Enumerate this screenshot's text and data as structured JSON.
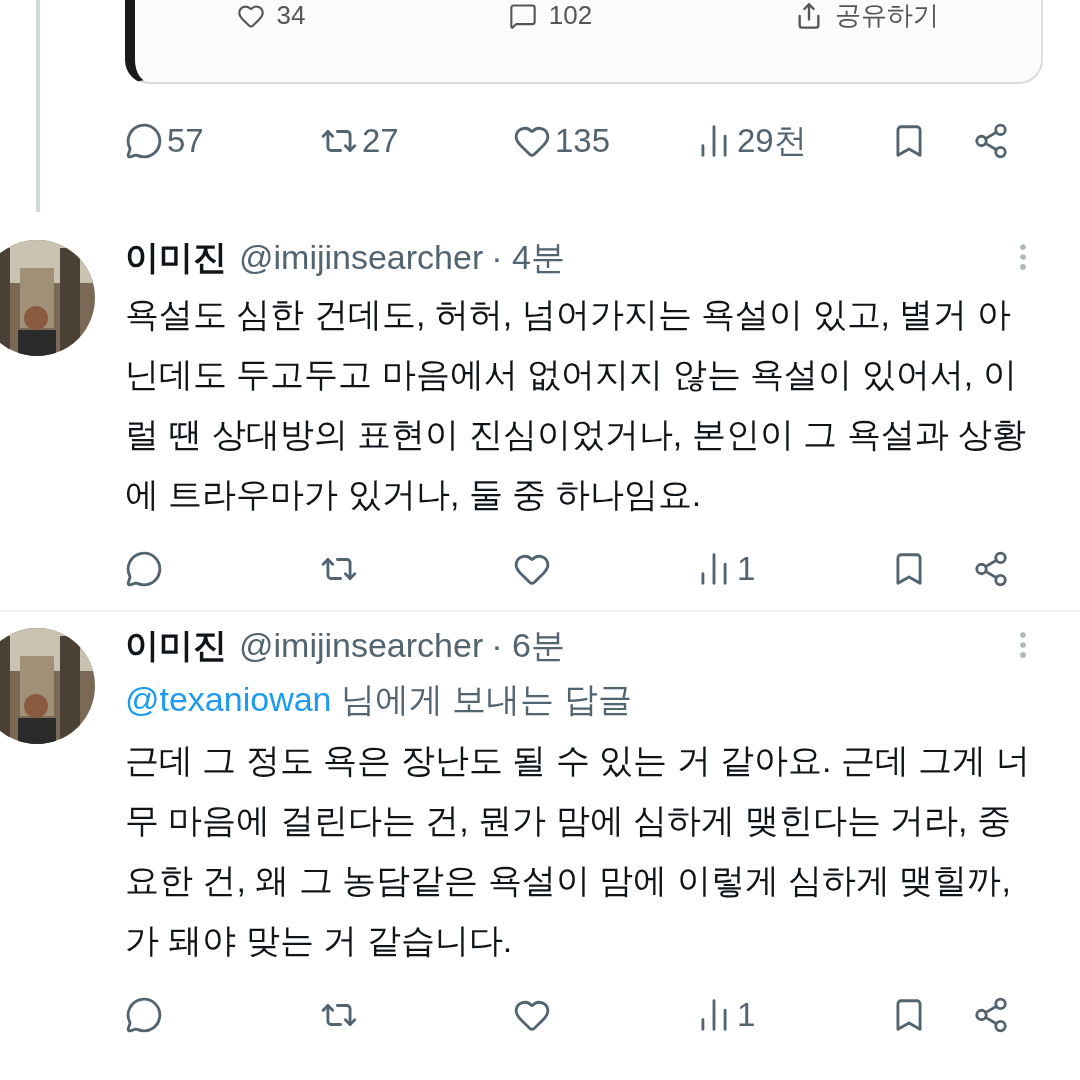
{
  "embedded_card": {
    "stats": [
      {
        "kind": "like",
        "label": "34"
      },
      {
        "kind": "comment",
        "label": "102"
      },
      {
        "kind": "share",
        "label": "공유하기"
      }
    ]
  },
  "main_actions": [
    {
      "kind": "reply",
      "label": "57"
    },
    {
      "kind": "repost",
      "label": "27"
    },
    {
      "kind": "like",
      "label": "135"
    },
    {
      "kind": "views",
      "label": "29천"
    },
    {
      "kind": "bookmark"
    },
    {
      "kind": "share"
    }
  ],
  "replies": [
    {
      "name": "이미진",
      "handle": "@imijinsearcher",
      "time": "· 4분",
      "body": "욕설도 심한 건데도, 허허, 넘어가지는 욕설이 있고, 별거 아닌데도 두고두고 마음에서 없어지지 않는 욕설이 있어서, 이럴 땐 상대방의 표현이 진심이었거나, 본인이 그 욕설과 상황에 트라우마가 있거나, 둘 중 하나임요.",
      "actions": [
        {
          "kind": "reply"
        },
        {
          "kind": "repost"
        },
        {
          "kind": "like"
        },
        {
          "kind": "views",
          "label": "1"
        },
        {
          "kind": "bookmark"
        },
        {
          "kind": "share"
        }
      ]
    },
    {
      "name": "이미진",
      "handle": "@imijinsearcher",
      "time": "· 6분",
      "replying_to": {
        "mention": "@texaniowan",
        "text": "님에게 보내는 답글"
      },
      "body": "근데 그 정도 욕은 장난도 될 수 있는 거 같아요. 근데 그게 너무 마음에 걸린다는 건, 뭔가 맘에 심하게 맺힌다는 거라, 중요한 건, 왜 그 농담같은 욕설이 맘에 이렇게 심하게 맺힐까,가 돼야 맞는 거 같습니다.",
      "actions": [
        {
          "kind": "reply"
        },
        {
          "kind": "repost"
        },
        {
          "kind": "like"
        },
        {
          "kind": "views",
          "label": "1"
        },
        {
          "kind": "bookmark"
        },
        {
          "kind": "share"
        }
      ]
    }
  ]
}
